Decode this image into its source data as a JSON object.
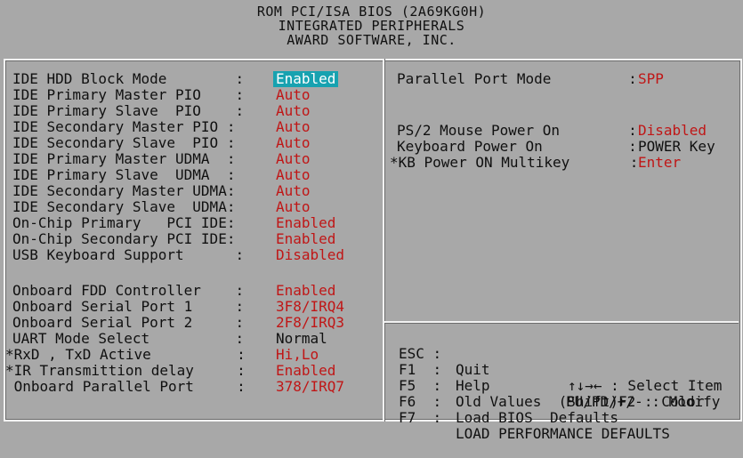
{
  "header": {
    "line1": "ROM PCI/ISA BIOS (2A69KG0H)",
    "line2": "INTEGRATED PERIPHERALS",
    "line3": "AWARD SOFTWARE, INC."
  },
  "left_settings": [
    {
      "label": "IDE HDD Block Mode        :",
      "value": "Enabled",
      "state": "selected"
    },
    {
      "label": "IDE Primary Master PIO    :",
      "value": "Auto",
      "state": "red"
    },
    {
      "label": "IDE Primary Slave  PIO    :",
      "value": "Auto",
      "state": "red"
    },
    {
      "label": "IDE Secondary Master PIO :",
      "value": "Auto",
      "state": "red"
    },
    {
      "label": "IDE Secondary Slave  PIO :",
      "value": "Auto",
      "state": "red"
    },
    {
      "label": "IDE Primary Master UDMA  :",
      "value": "Auto",
      "state": "red"
    },
    {
      "label": "IDE Primary Slave  UDMA  :",
      "value": "Auto",
      "state": "red"
    },
    {
      "label": "IDE Secondary Master UDMA:",
      "value": "Auto",
      "state": "red"
    },
    {
      "label": "IDE Secondary Slave  UDMA:",
      "value": "Auto",
      "state": "red"
    },
    {
      "label": "On-Chip Primary   PCI IDE:",
      "value": "Enabled",
      "state": "red"
    },
    {
      "label": "On-Chip Secondary PCI IDE:",
      "value": "Enabled",
      "state": "red"
    },
    {
      "label": "USB Keyboard Support      :",
      "value": "Disabled",
      "state": "red"
    },
    {
      "label": "Onboard FDD Controller    :",
      "value": "Enabled",
      "state": "red"
    },
    {
      "label": "Onboard Serial Port 1     :",
      "value": "3F8/IRQ4",
      "state": "red"
    },
    {
      "label": "Onboard Serial Port 2     :",
      "value": "2F8/IRQ3",
      "state": "red"
    },
    {
      "label": "UART Mode Select          :",
      "value": "Normal",
      "state": "normal"
    },
    {
      "label": "*RxD , TxD Active          :",
      "value": "Hi,Lo",
      "state": "red"
    },
    {
      "label": "*IR Transmittion delay     :",
      "value": "Enabled",
      "state": "red"
    },
    {
      "label": " Onboard Parallel Port     :",
      "value": "378/IRQ7",
      "state": "red"
    }
  ],
  "right_settings": [
    {
      "label": "Parallel Port Mode         :",
      "value": "SPP",
      "state": "red"
    },
    {
      "label": "PS/2 Mouse Power On        :",
      "value": "Disabled",
      "state": "red"
    },
    {
      "label": "Keyboard Power On          :",
      "value": "POWER Key",
      "state": "normal"
    },
    {
      "label": "*KB Power ON Multikey       :",
      "value": "Enter",
      "state": "red"
    }
  ],
  "help": [
    {
      "key": "ESC :",
      "desc": "Quit",
      "right": "↑↓→← : Select Item"
    },
    {
      "key": "F1  :",
      "desc": "Help",
      "right": "PU/PD/+/- : Modify"
    },
    {
      "key": "F5  :",
      "desc": "Old Values  (Shift)F2 : Color",
      "right": ""
    },
    {
      "key": "F6  :",
      "desc": "Load BIOS  Defaults",
      "right": ""
    },
    {
      "key": "F7  :",
      "desc": "LOAD PERFORMANCE DEFAULTS",
      "right": ""
    }
  ],
  "colors": {
    "background": "#a8a8a8",
    "value_red": "#c01616",
    "highlight": "#17a2b0",
    "text": "#101010"
  }
}
